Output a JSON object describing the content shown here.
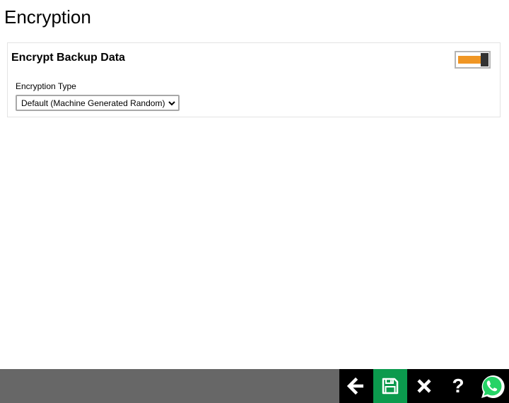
{
  "page": {
    "title": "Encryption"
  },
  "panel": {
    "title": "Encrypt Backup Data",
    "toggle": {
      "on": true,
      "accent_color": "#f09624",
      "icon": "toggle-switch"
    },
    "encryption_type": {
      "label": "Encryption Type",
      "selected": "Default (Machine Generated Random)"
    }
  },
  "toolbar": {
    "bar_color": "#676767",
    "buttons": [
      {
        "name": "back",
        "icon": "arrow-left-icon"
      },
      {
        "name": "save",
        "icon": "floppy-disk-icon",
        "color": "#0b9a4d"
      },
      {
        "name": "close",
        "icon": "close-x-icon"
      },
      {
        "name": "help",
        "icon": "question-mark-icon",
        "glyph": "?"
      },
      {
        "name": "whatsapp",
        "icon": "whatsapp-icon",
        "color": "#25d366"
      }
    ]
  }
}
